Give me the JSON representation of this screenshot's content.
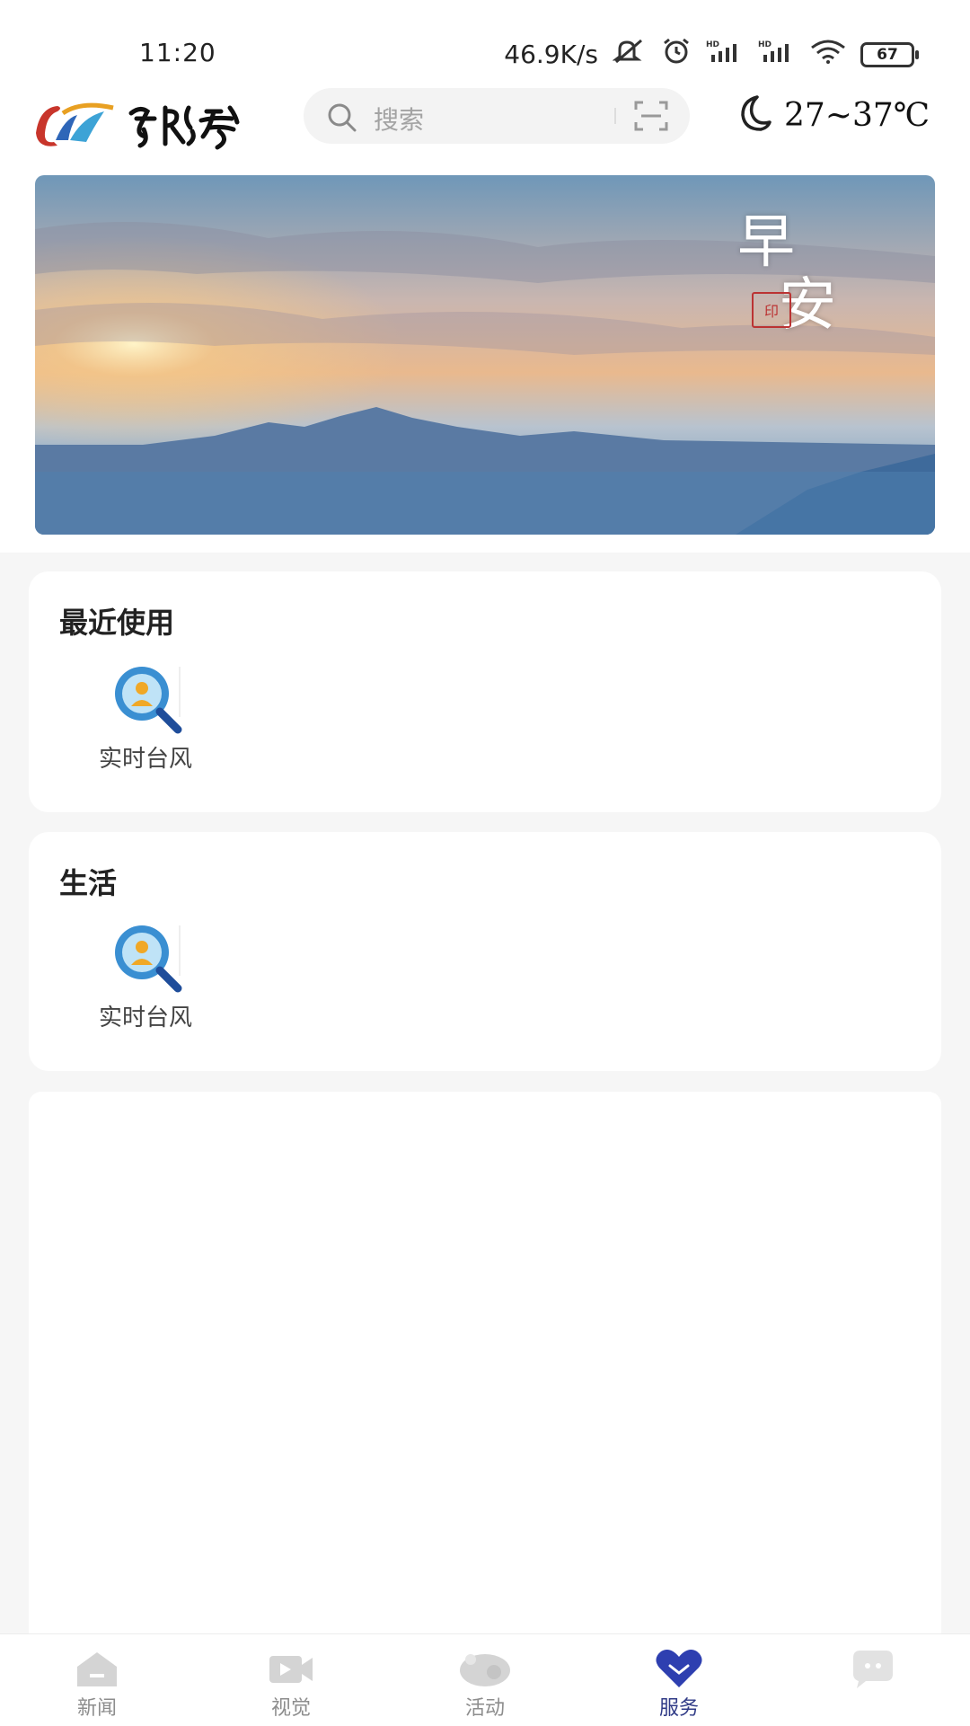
{
  "status_bar": {
    "time": "11:20",
    "network_speed": "46.9K/s",
    "battery": "67"
  },
  "header": {
    "logo_alt": "LOGO",
    "search_placeholder": "搜索",
    "temperature": "27~37℃"
  },
  "banner": {
    "greeting_line1": "早",
    "greeting_line2": "安"
  },
  "sections": [
    {
      "title": "最近使用",
      "items": [
        {
          "label": "实时台风",
          "icon": "typhoon-search-icon"
        }
      ]
    },
    {
      "title": "生活",
      "items": [
        {
          "label": "实时台风",
          "icon": "typhoon-search-icon"
        }
      ]
    }
  ],
  "tabs": [
    {
      "label": "新闻",
      "icon": "home-icon",
      "active": false
    },
    {
      "label": "视觉",
      "icon": "video-icon",
      "active": false
    },
    {
      "label": "活动",
      "icon": "activity-icon",
      "active": false
    },
    {
      "label": "服务",
      "icon": "heart-icon",
      "active": true
    },
    {
      "label": "",
      "icon": "chat-icon",
      "active": false
    }
  ],
  "colors": {
    "accent": "#2f3a86",
    "tab_inactive": "#bdbdbd",
    "background": "#f6f6f6"
  }
}
